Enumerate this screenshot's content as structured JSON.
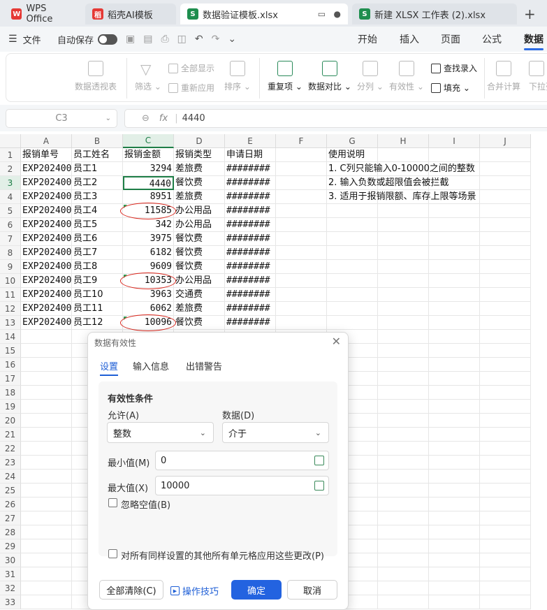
{
  "tabs": [
    {
      "label": "WPS Office",
      "icon": "wps-logo-icon",
      "color": "#e53935"
    },
    {
      "label": "稻壳AI模板",
      "icon": "docer-logo-icon",
      "color": "#e53935"
    },
    {
      "label": "数据验证模板.xlsx",
      "icon": "spreadsheet-icon",
      "color": "#1e8e4e"
    },
    {
      "label": "新建 XLSX 工作表 (2).xlsx",
      "icon": "spreadsheet-icon",
      "color": "#1e8e4e"
    }
  ],
  "quickbar": {
    "menu_label": "文件",
    "autosave_label": "自动保存",
    "menus": [
      "开始",
      "插入",
      "页面",
      "公式",
      "数据"
    ],
    "active_menu": "数据"
  },
  "ribbon": {
    "pivot": "数据透视表",
    "filter": "筛选",
    "show_all": "全部显示",
    "reapply": "重新应用",
    "sort": "排序",
    "duplicates": "重复项",
    "compare": "数据对比",
    "split": "分列",
    "validity": "有效性",
    "lookup_entry": "查找录入",
    "fill": "填充",
    "merge_calc": "合并计算",
    "dropdown_list": "下拉列"
  },
  "formula_bar": {
    "cell_ref": "C3",
    "fx": "fx",
    "value": "4440"
  },
  "sheet": {
    "columns": [
      "A",
      "B",
      "C",
      "D",
      "E",
      "F",
      "G",
      "H",
      "I",
      "J"
    ],
    "rows": [
      "1",
      "2",
      "3",
      "4",
      "5",
      "6",
      "7",
      "8",
      "9",
      "10",
      "11",
      "12",
      "13",
      "14",
      "15",
      "16",
      "17",
      "18",
      "19",
      "20",
      "21",
      "22",
      "23",
      "24",
      "25",
      "26",
      "27",
      "28",
      "29",
      "30",
      "31",
      "32",
      "33"
    ],
    "header": [
      "报销单号",
      "员工姓名",
      "报销金额",
      "报销类型",
      "申请日期"
    ],
    "data": [
      [
        "EXP20240001",
        "员工1",
        "3294",
        "差旅费",
        "########"
      ],
      [
        "EXP20240002",
        "员工2",
        "4440",
        "餐饮费",
        "########"
      ],
      [
        "EXP20240003",
        "员工3",
        "8951",
        "差旅费",
        "########"
      ],
      [
        "EXP20240004",
        "员工4",
        "11585",
        "办公用品",
        "########"
      ],
      [
        "EXP20240005",
        "员工5",
        "342",
        "办公用品",
        "########"
      ],
      [
        "EXP20240006",
        "员工6",
        "3975",
        "餐饮费",
        "########"
      ],
      [
        "EXP20240007",
        "员工7",
        "6182",
        "餐饮费",
        "########"
      ],
      [
        "EXP20240008",
        "员工8",
        "9609",
        "餐饮费",
        "########"
      ],
      [
        "EXP20240009",
        "员工9",
        "10353",
        "办公用品",
        "########"
      ],
      [
        "EXP20240010",
        "员工10",
        "3963",
        "交通费",
        "########"
      ],
      [
        "EXP20240011",
        "员工11",
        "6062",
        "差旅费",
        "########"
      ],
      [
        "EXP20240012",
        "员工12",
        "10096",
        "餐饮费",
        "########"
      ]
    ],
    "notes_title": "使用说明",
    "notes": [
      "1. C列只能输入0-10000之间的整数",
      "2. 输入负数或超限值会被拦截",
      "3. 适用于报销限额、库存上限等场景"
    ]
  },
  "dialog": {
    "title": "数据有效性",
    "tabs": [
      "设置",
      "输入信息",
      "出错警告"
    ],
    "section_title": "有效性条件",
    "allow_label": "允许(A)",
    "allow_value": "整数",
    "data_label": "数据(D)",
    "data_value": "介于",
    "min_label": "最小值(M)",
    "min_value": "0",
    "max_label": "最大值(X)",
    "max_value": "10000",
    "ignore_blank": "忽略空值(B)",
    "apply_all": "对所有同样设置的其他所有单元格应用这些更改(P)",
    "clear_all": "全部清除(C)",
    "tips": "操作技巧",
    "ok": "确定",
    "cancel": "取消"
  }
}
